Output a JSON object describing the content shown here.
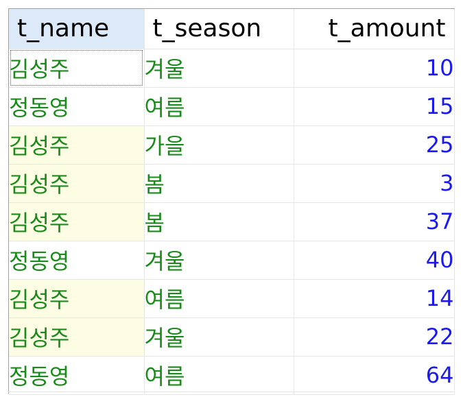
{
  "grid": {
    "columns": [
      "t_name",
      "t_season",
      "t_amount"
    ],
    "rows": [
      {
        "t_name": "김성주",
        "t_season": "겨울",
        "t_amount": "10"
      },
      {
        "t_name": "정동영",
        "t_season": "여름",
        "t_amount": "15"
      },
      {
        "t_name": "김성주",
        "t_season": "가을",
        "t_amount": "25"
      },
      {
        "t_name": "김성주",
        "t_season": "봄",
        "t_amount": "3"
      },
      {
        "t_name": "김성주",
        "t_season": "봄",
        "t_amount": "37"
      },
      {
        "t_name": "정동영",
        "t_season": "겨울",
        "t_amount": "40"
      },
      {
        "t_name": "김성주",
        "t_season": "여름",
        "t_amount": "14"
      },
      {
        "t_name": "김성주",
        "t_season": "겨울",
        "t_amount": "22"
      },
      {
        "t_name": "정동영",
        "t_season": "여름",
        "t_amount": "64"
      }
    ]
  },
  "colors": {
    "text_value": "#1a8a1a",
    "number_value": "#1a1af0",
    "header_sorted_bg": "#dbe9f8",
    "highlight_cell_bg": "#fdfde4",
    "gridline": "#e6e6e6"
  }
}
